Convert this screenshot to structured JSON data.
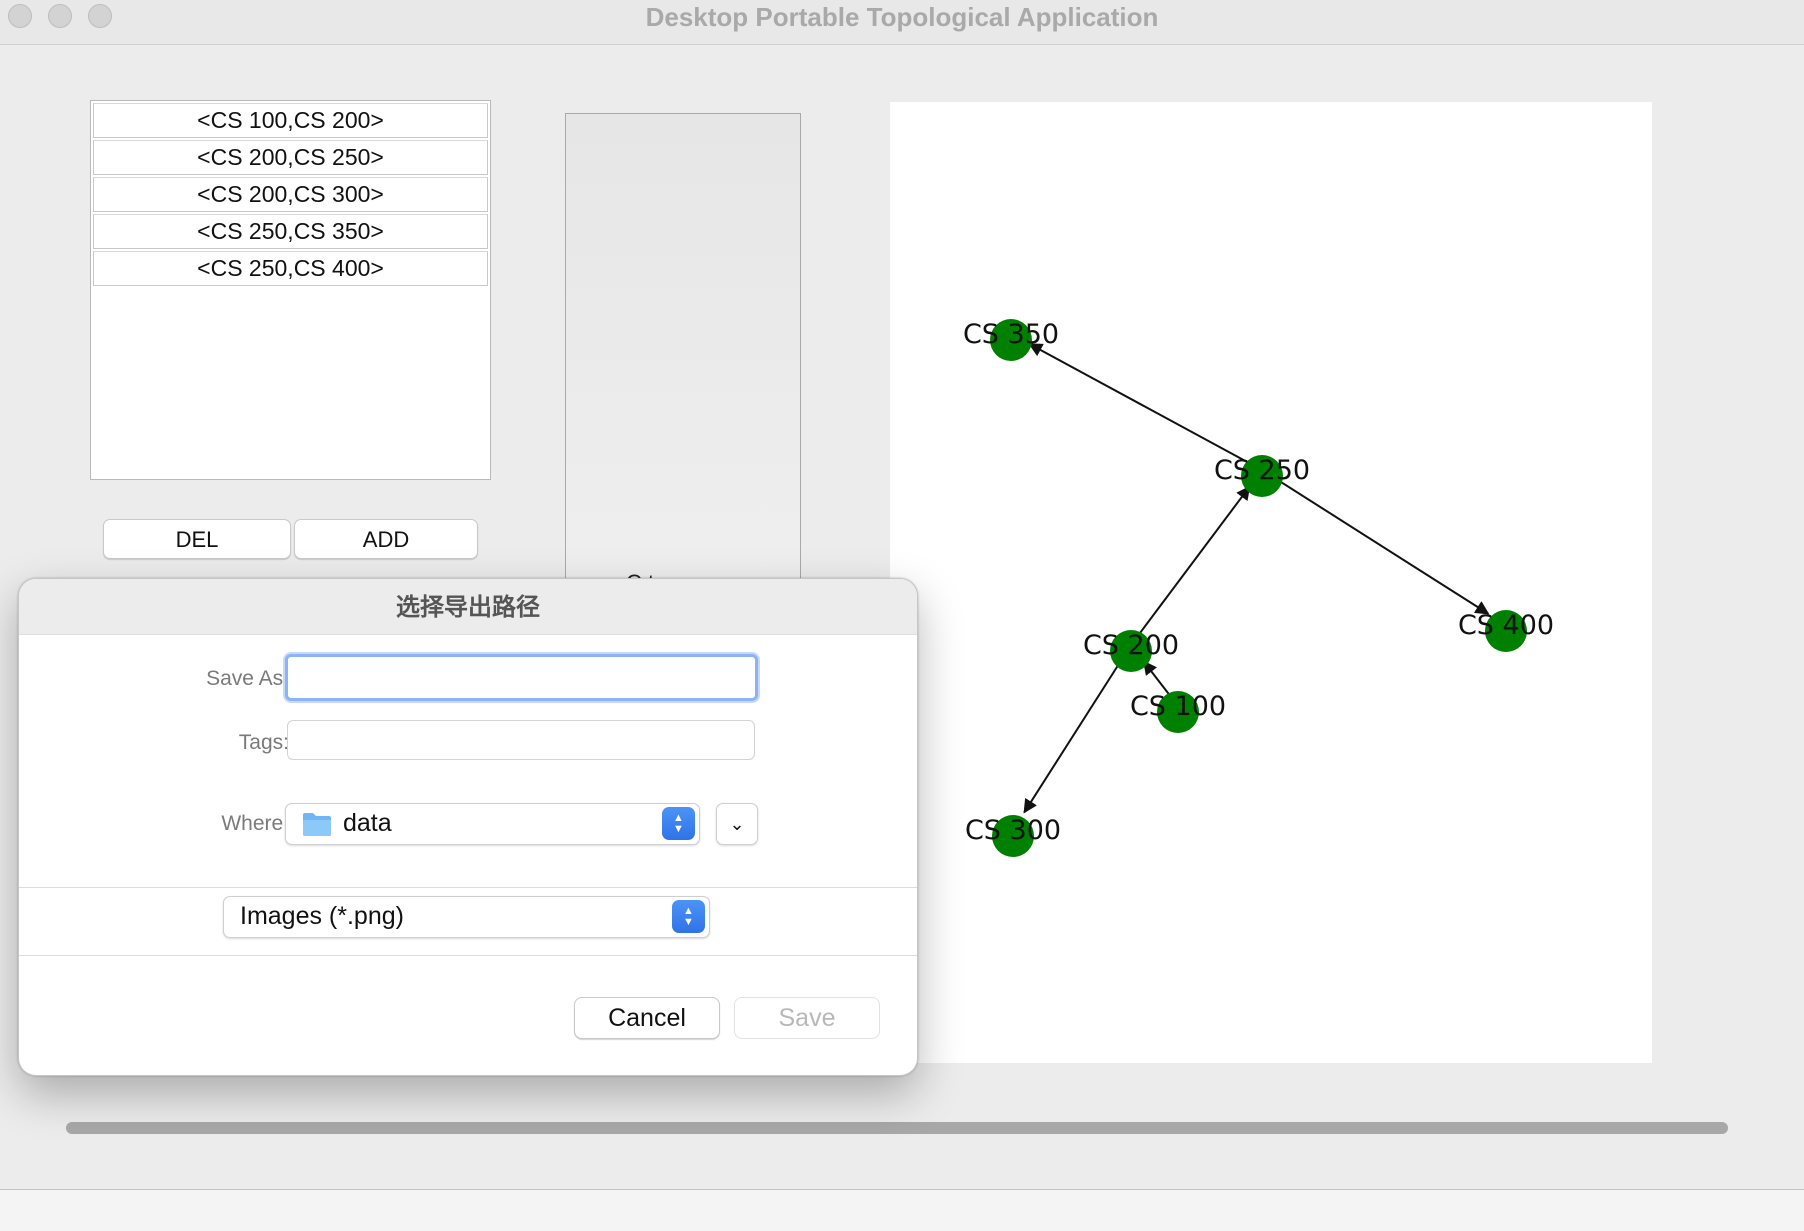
{
  "window": {
    "title": "Desktop Portable Topological Application"
  },
  "edge_list": [
    "<CS 100,CS 200>",
    "<CS 200,CS 250>",
    "<CS 200,CS 300>",
    "<CS 250,CS 350>",
    "<CS 250,CS 400>"
  ],
  "buttons": {
    "del": "DEL",
    "add": "ADD"
  },
  "side_panel": {
    "partial_text": "C   t"
  },
  "graph": {
    "node_color": "#008000",
    "nodes": [
      "CS 350",
      "CS 250",
      "CS 200",
      "CS 400",
      "CS 100",
      "CS 300"
    ],
    "edges": [
      {
        "from": "CS 100",
        "to": "CS 200"
      },
      {
        "from": "CS 200",
        "to": "CS 250"
      },
      {
        "from": "CS 200",
        "to": "CS 300"
      },
      {
        "from": "CS 250",
        "to": "CS 350"
      },
      {
        "from": "CS 250",
        "to": "CS 400"
      }
    ]
  },
  "dialog": {
    "title": "选择导出路径",
    "save_as_label": "Save As:",
    "save_as_value": "",
    "tags_label": "Tags:",
    "tags_value": "",
    "where_label": "Where:",
    "where_value": "data",
    "file_type": "Images (*.png)",
    "cancel_label": "Cancel",
    "save_label": "Save"
  }
}
